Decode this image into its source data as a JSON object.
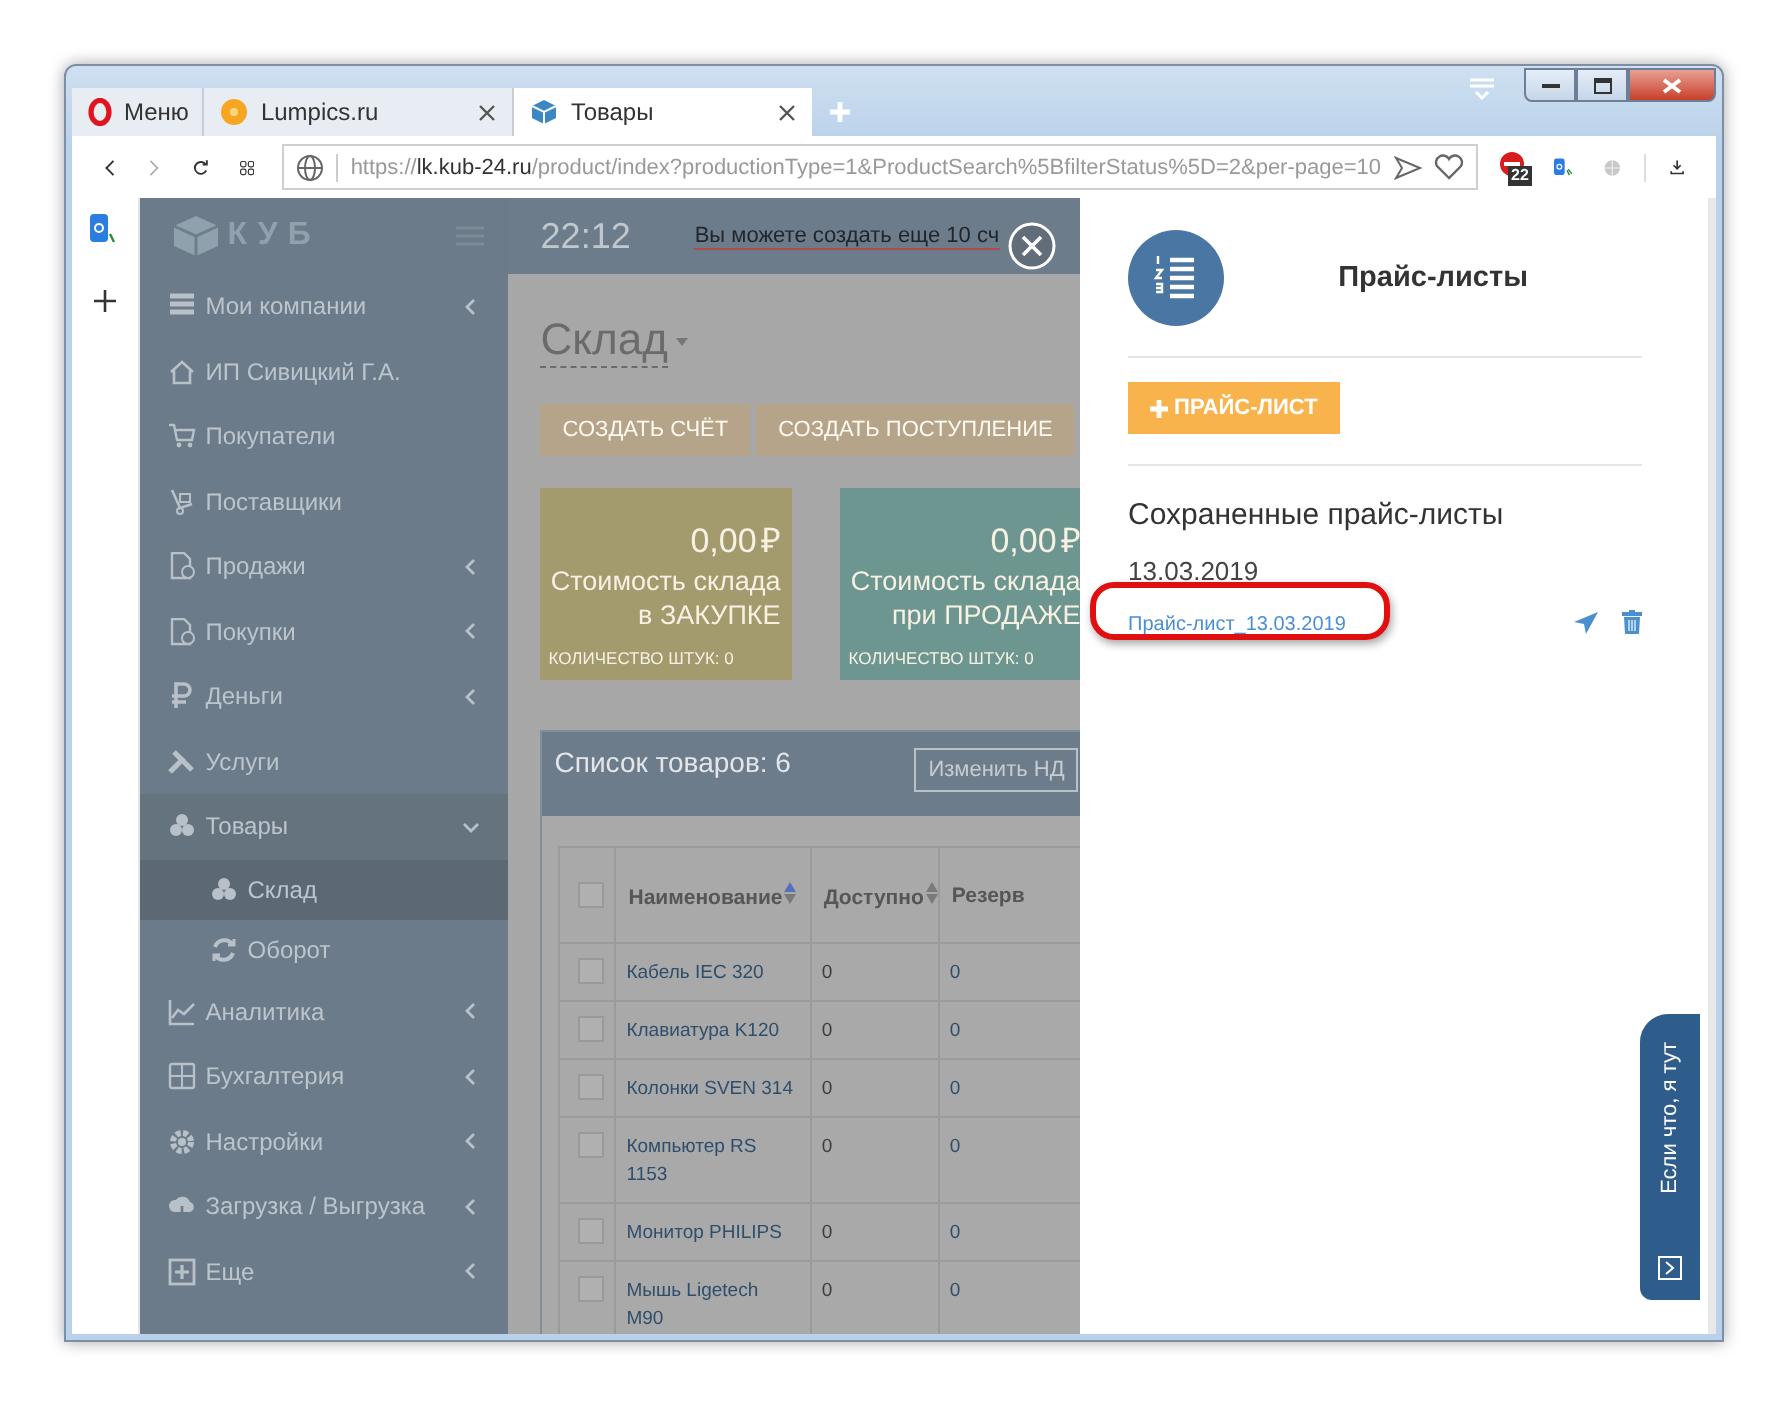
{
  "browser": {
    "tabs": [
      {
        "kind": "menu",
        "label": "Меню",
        "selected": false
      },
      {
        "kind": "page",
        "label": "Lumpics.ru",
        "selected": false
      },
      {
        "kind": "page",
        "label": "Товары",
        "selected": true
      }
    ],
    "url": {
      "scheme": "https://",
      "host": "lk.kub-24.ru",
      "path": "/product/index?productionType=1&ProductSearch%5BfilterStatus%5D=2&per-page=10"
    },
    "extension_badge": "22"
  },
  "sidebar": {
    "logo": "КУБ",
    "items": [
      {
        "label": "Мои компании",
        "expandable": true,
        "expanded": false
      },
      {
        "label": "ИП Сивицкий Г.А.",
        "expandable": false
      },
      {
        "label": "Покупатели",
        "expandable": false
      },
      {
        "label": "Поставщики",
        "expandable": false
      },
      {
        "label": "Продажи",
        "expandable": true,
        "expanded": false
      },
      {
        "label": "Покупки",
        "expandable": true,
        "expanded": false
      },
      {
        "label": "Деньги",
        "expandable": true,
        "expanded": false
      },
      {
        "label": "Услуги",
        "expandable": false
      },
      {
        "label": "Товары",
        "expandable": true,
        "expanded": true,
        "children": [
          {
            "label": "Склад",
            "selected": true
          },
          {
            "label": "Оборот",
            "selected": false
          }
        ]
      },
      {
        "label": "Аналитика",
        "expandable": true,
        "expanded": false
      },
      {
        "label": "Бухгалтерия",
        "expandable": true,
        "expanded": false
      },
      {
        "label": "Настройки",
        "expandable": true,
        "expanded": false
      },
      {
        "label": "Загрузка / Выгрузка",
        "expandable": true,
        "expanded": false
      },
      {
        "label": "Еще",
        "expandable": true,
        "expanded": false
      }
    ]
  },
  "header": {
    "time": "22:12",
    "notice": "Вы можете создать еще 10 сч"
  },
  "page": {
    "title": "Склад",
    "buttons": [
      "СОЗДАТЬ СЧЁТ",
      "СОЗДАТЬ ПОСТУПЛЕНИЕ"
    ],
    "cards": [
      {
        "amount": "0,00",
        "currency": "₽",
        "label": "Стоимость склада в ЗАКУПКЕ",
        "count": "КОЛИЧЕСТВО ШТУК: 0",
        "color": "#a39a6e"
      },
      {
        "amount": "0,00",
        "currency": "₽",
        "label": "Стоимость склада при ПРОДАЖЕ",
        "count": "КОЛИЧЕСТВО ШТУК: 0",
        "color": "#6e9690"
      }
    ],
    "table": {
      "title": "Список товаров: 6",
      "action": "Изменить НД",
      "all_checked": false,
      "columns": [
        {
          "label": "Наименование",
          "sorted": true
        },
        {
          "label": "Доступно",
          "sorted": false
        },
        {
          "label": "Резерв"
        }
      ],
      "rows": [
        {
          "name": "Кабель IEC 320",
          "available": "0",
          "reserve": "0",
          "checked": false
        },
        {
          "name": "Клавиатура K120",
          "available": "0",
          "reserve": "0",
          "checked": false
        },
        {
          "name": "Колонки SVEN 314",
          "available": "0",
          "reserve": "0",
          "checked": false
        },
        {
          "name": "Компьютер RS 1153",
          "available": "0",
          "reserve": "0",
          "checked": false
        },
        {
          "name": "Монитор PHILIPS",
          "available": "0",
          "reserve": "0",
          "checked": false
        },
        {
          "name": "Мышь Ligetech M90",
          "available": "0",
          "reserve": "0",
          "checked": false
        }
      ]
    }
  },
  "panel": {
    "title": "Прайс-листы",
    "add_button": "ПРАЙС-ЛИСТ",
    "section": "Сохраненные прайс-листы",
    "groups": [
      {
        "date": "13.03.2019",
        "items": [
          {
            "name": "Прайс-лист_13.03.2019",
            "highlighted": true
          }
        ]
      }
    ]
  },
  "help_tab": "Если что, я тут"
}
